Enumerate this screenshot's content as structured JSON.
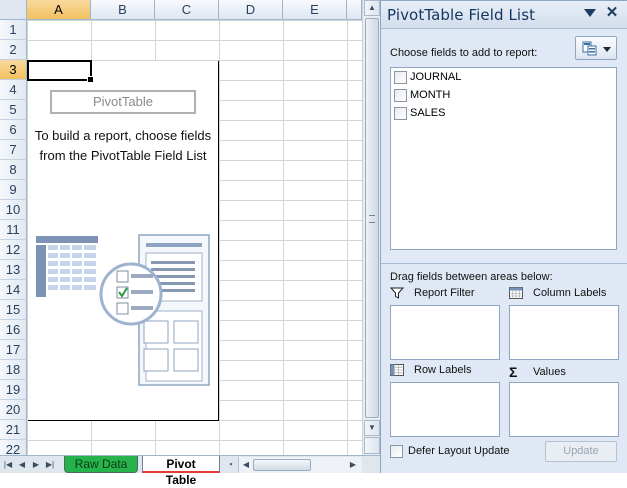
{
  "sheet": {
    "columns": [
      "A",
      "B",
      "C",
      "D",
      "E"
    ],
    "selected_column": "A",
    "rows": [
      "1",
      "2",
      "3",
      "4",
      "5",
      "6",
      "7",
      "8",
      "9",
      "10",
      "11",
      "12",
      "13",
      "14",
      "15",
      "16",
      "17",
      "18",
      "19",
      "20",
      "21",
      "22"
    ],
    "selected_row": "3"
  },
  "pivot_placeholder": {
    "title": "PivotTable",
    "instructions": "To build a report, choose fields from the PivotTable Field List"
  },
  "tabs": {
    "raw_data": "Raw Data",
    "pivot_table": "Pivot Table",
    "raw_data_color": "#27b34b"
  },
  "field_list": {
    "title": "PivotTable Field List",
    "choose_label": "Choose fields to add to report:",
    "fields": [
      {
        "label": "JOURNAL",
        "checked": false
      },
      {
        "label": "MONTH",
        "checked": false
      },
      {
        "label": "SALES",
        "checked": false
      }
    ],
    "drag_label": "Drag fields between areas below:",
    "areas": {
      "report_filter": "Report Filter",
      "column_labels": "Column Labels",
      "row_labels": "Row Labels",
      "values": "Values"
    },
    "defer_label": "Defer Layout Update",
    "update_label": "Update",
    "icons": {
      "dropdown": "dropdown-arrow-icon",
      "close": "close-icon",
      "layout": "field-layout-icon",
      "filter": "filter-icon",
      "columns": "column-labels-icon",
      "rows": "row-labels-icon",
      "values": "sigma-icon"
    }
  }
}
